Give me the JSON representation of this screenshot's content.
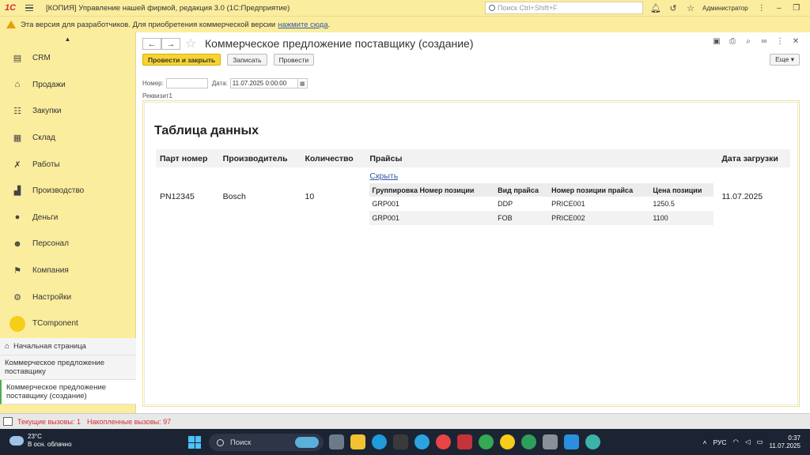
{
  "titlebar": {
    "logo": "1С",
    "title": "[КОПИЯ] Управление нашей фирмой, редакция 3.0  (1С:Предприятие)",
    "search_placeholder": "Поиск Ctrl+Shift+F",
    "user": "Администратор"
  },
  "warning": {
    "text": "Эта версия для разработчиков. Для приобретения коммерческой версии",
    "link": "нажмите сюда",
    "suffix": "."
  },
  "sidebar": {
    "items": [
      {
        "label": "CRM",
        "icon": "crm-icon",
        "glyph": "▤"
      },
      {
        "label": "Продажи",
        "icon": "sales-icon",
        "glyph": "⌂"
      },
      {
        "label": "Закупки",
        "icon": "purchases-icon",
        "glyph": "☷"
      },
      {
        "label": "Склад",
        "icon": "warehouse-icon",
        "glyph": "▦"
      },
      {
        "label": "Работы",
        "icon": "tools-icon",
        "glyph": "✗"
      },
      {
        "label": "Производство",
        "icon": "factory-icon",
        "glyph": "▟"
      },
      {
        "label": "Деньги",
        "icon": "money-icon",
        "glyph": "●"
      },
      {
        "label": "Персонал",
        "icon": "staff-icon",
        "glyph": "☻"
      },
      {
        "label": "Компания",
        "icon": "flag-icon",
        "glyph": "⚑"
      },
      {
        "label": "Настройки",
        "icon": "gear-icon",
        "glyph": "⚙"
      },
      {
        "label": "TComponent",
        "icon": "tcomponent-icon",
        "glyph": ""
      }
    ],
    "open_windows": [
      "Начальная страница",
      "Коммерческое предложение поставщику",
      "Коммерческое предложение поставщику (создание)"
    ]
  },
  "form": {
    "title": "Коммерческое предложение поставщику (создание)",
    "buttons": {
      "post_close": "Провести и закрыть",
      "save": "Записать",
      "post": "Провести",
      "more": "Еще ▾"
    },
    "fields": {
      "number_label": "Номер:",
      "number_value": "",
      "date_label": "Дата:",
      "date_value": "11.07.2025  0:00:00"
    },
    "requisite_label": "Реквизит1"
  },
  "data_table": {
    "title": "Таблица данных",
    "columns": [
      "Парт номер",
      "Производитель",
      "Количество",
      "Прайсы",
      "Дата загрузки"
    ],
    "row": {
      "part_number": "PN12345",
      "manufacturer": "Bosch",
      "quantity": "10",
      "hide_link": "Скрыть",
      "load_date": "11.07.2025"
    },
    "prices": {
      "columns": [
        "Группировка Номер позиции",
        "Вид прайса",
        "Номер позиции прайса",
        "Цена позиции"
      ],
      "rows": [
        [
          "GRP001",
          "DDP",
          "PRICE001",
          "1250.5"
        ],
        [
          "GRP001",
          "FOB",
          "PRICE002",
          "1100"
        ]
      ]
    }
  },
  "statusbar": {
    "current_calls": "Текущие вызовы: 1",
    "accumulated_calls": "Накопленные вызовы: 97"
  },
  "taskbar": {
    "temperature": "23°C",
    "weather": "В осн. облачно",
    "search": "Поиск",
    "lang": "РУС",
    "time": "0:37",
    "date": "11.07.2025"
  },
  "colors": {
    "accent_yellow": "#fbed9e",
    "primary_button": "#f8d431",
    "status_red": "#d32f2f",
    "link_blue": "#3558a4"
  }
}
